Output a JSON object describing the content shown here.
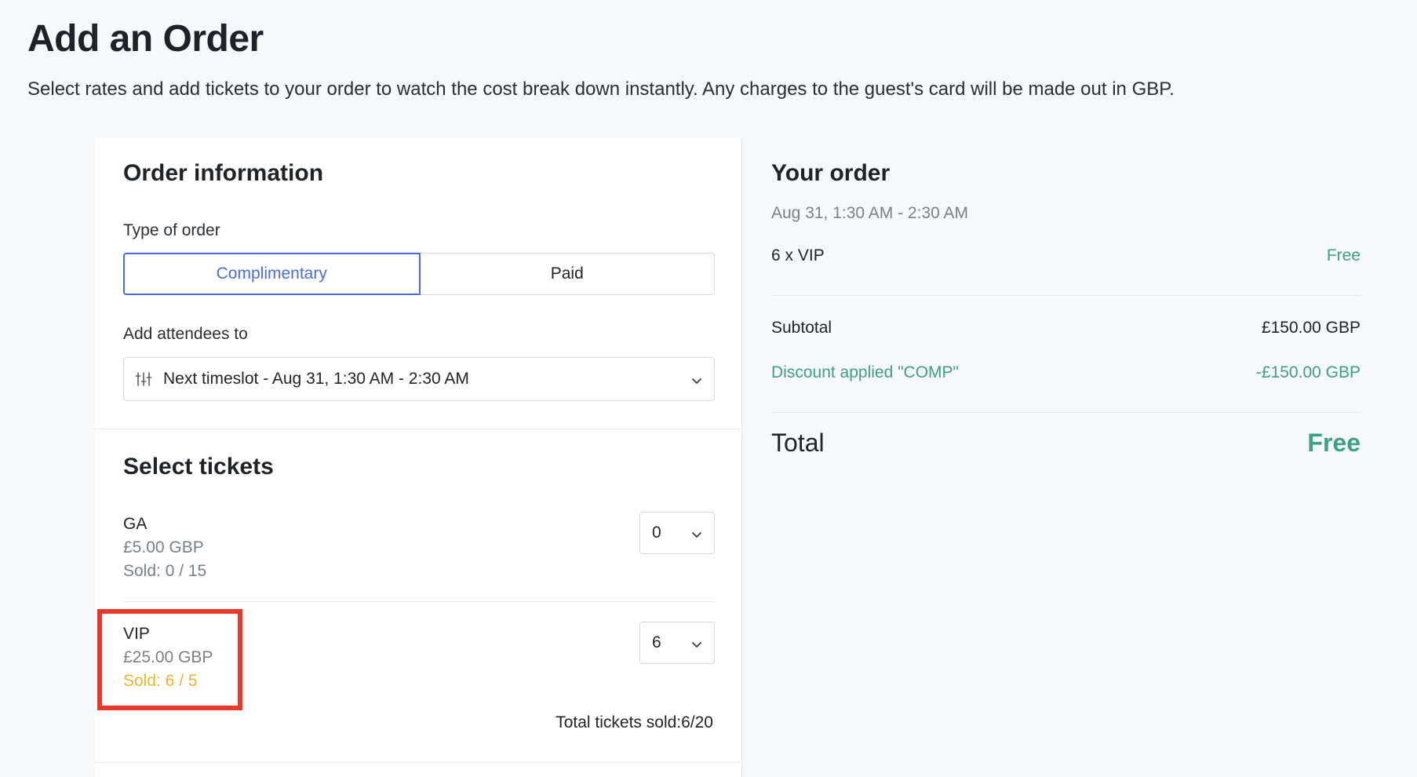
{
  "header": {
    "title": "Add an Order",
    "subtitle": "Select rates and add tickets to your order to watch the cost break down instantly. Any charges to the guest's card will be made out in GBP."
  },
  "order_info": {
    "title": "Order information",
    "type_label": "Type of order",
    "type_options": [
      "Complimentary",
      "Paid"
    ],
    "selected_type": "Complimentary",
    "attendees_label": "Add attendees to",
    "timeslot_value": "Next timeslot - Aug 31, 1:30 AM - 2:30 AM"
  },
  "tickets": {
    "title": "Select tickets",
    "items": [
      {
        "name": "GA",
        "price": "£5.00 GBP",
        "sold": "Sold: 0 / 15",
        "quantity": "0"
      },
      {
        "name": "VIP",
        "price": "£25.00 GBP",
        "sold": "Sold: 6 / 5",
        "quantity": "6"
      }
    ],
    "total_sold": "Total tickets sold:6/20"
  },
  "your_order": {
    "title": "Your order",
    "datetime": "Aug 31, 1:30 AM - 2:30 AM",
    "line_item": {
      "label": "6 x VIP",
      "value": "Free"
    },
    "subtotal": {
      "label": "Subtotal",
      "value": "£150.00 GBP"
    },
    "discount": {
      "label": "Discount applied \"COMP\"",
      "value": "-£150.00 GBP"
    },
    "total": {
      "label": "Total",
      "value": "Free"
    }
  },
  "colors": {
    "accent": "#4a6be0",
    "green": "#3c9f86",
    "warning": "#f0b429",
    "highlight": "#e8392b"
  }
}
